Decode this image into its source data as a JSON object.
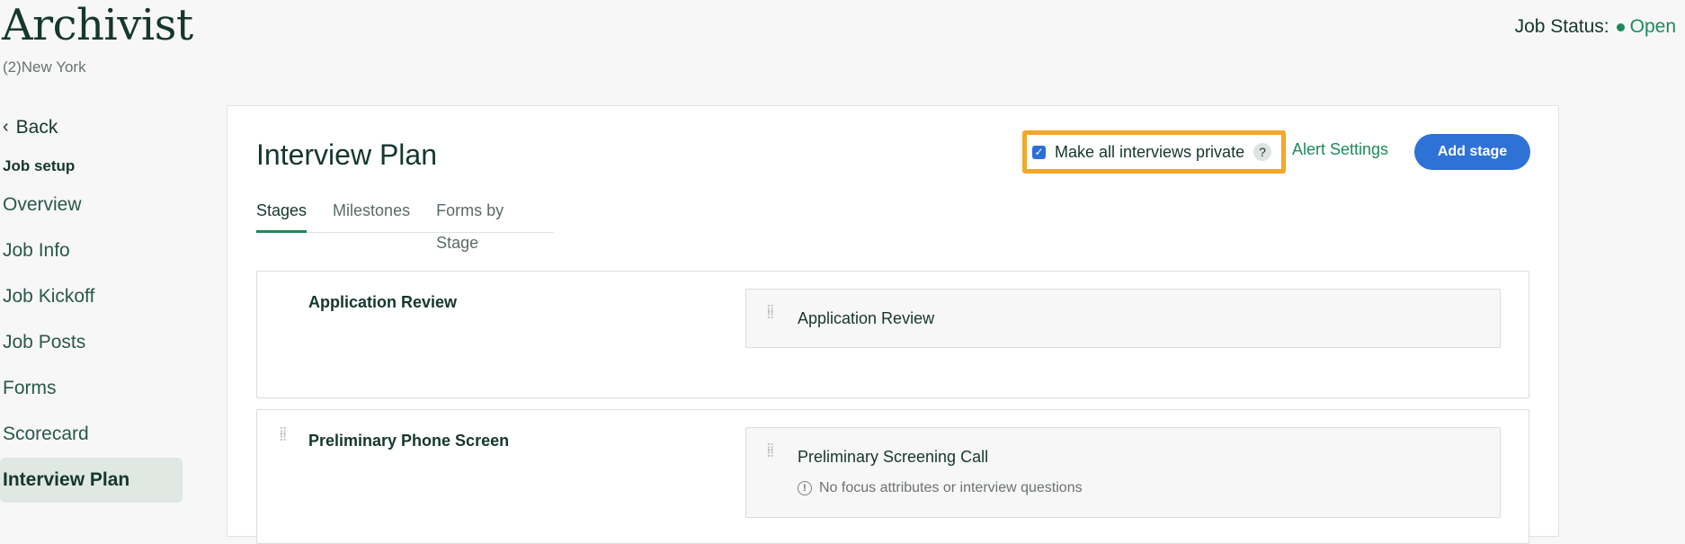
{
  "header": {
    "title": "Archivist",
    "location": "(2)New York",
    "status_label": "Job Status:",
    "status_value": "Open",
    "status_color": "#1e8a5a"
  },
  "sidebar": {
    "back_label": "Back",
    "section_label": "Job setup",
    "items": [
      {
        "label": "Overview"
      },
      {
        "label": "Job Info"
      },
      {
        "label": "Job Kickoff"
      },
      {
        "label": "Job Posts"
      },
      {
        "label": "Forms"
      },
      {
        "label": "Scorecard"
      },
      {
        "label": "Interview Plan",
        "active": true
      }
    ]
  },
  "main": {
    "title": "Interview Plan",
    "tabs": [
      {
        "label": "Stages",
        "active": true
      },
      {
        "label": "Milestones"
      },
      {
        "label": "Forms by Stage"
      }
    ],
    "private_checkbox": {
      "label": "Make all interviews private",
      "checked": true,
      "help": "?"
    },
    "alert_settings_label": "Alert Settings",
    "add_stage_label": "Add stage",
    "accent_color": "#2f72d6"
  },
  "stages": [
    {
      "name": "Application Review",
      "interviews": [
        {
          "name": "Application Review"
        }
      ]
    },
    {
      "name": "Preliminary Phone Screen",
      "interviews": [
        {
          "name": "Preliminary Screening Call",
          "note": "No focus attributes or interview questions"
        }
      ]
    }
  ]
}
